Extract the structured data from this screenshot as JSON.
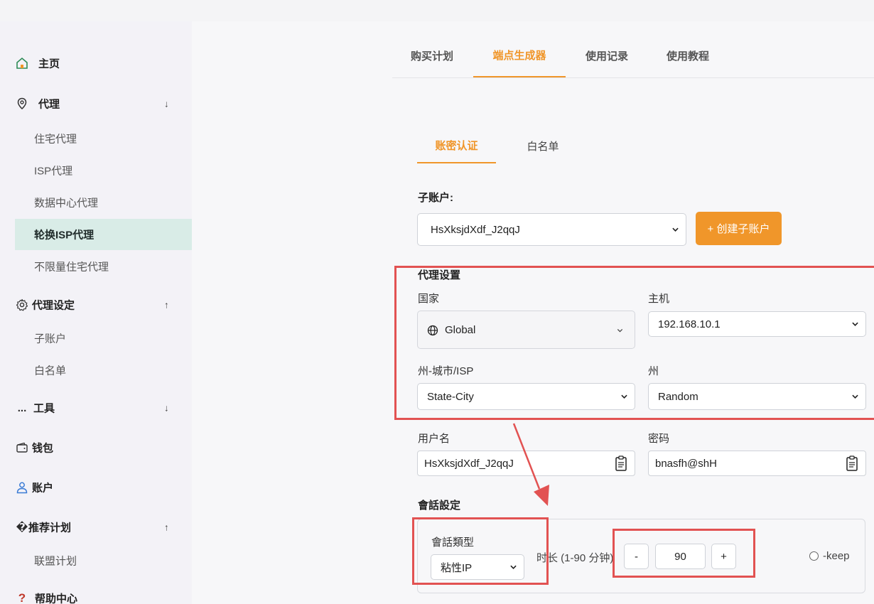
{
  "sidebar": {
    "home": "主页",
    "proxy": "代理",
    "proxy_items": [
      "住宅代理",
      "ISP代理",
      "数据中心代理",
      "轮换ISP代理",
      "不限量住宅代理"
    ],
    "proxy_settings": "代理设定",
    "settings_items": [
      "子账户",
      "白名单"
    ],
    "tools": "工具",
    "tools_prefix": "...",
    "wallet": "钱包",
    "account": "账户",
    "referral": "推荐计划",
    "referral_prefix": "�",
    "referral_items": [
      "联盟计划"
    ],
    "help": "帮助中心",
    "arrow_down": "↓",
    "arrow_up": "↑"
  },
  "top_tabs": [
    "购买计划",
    "端点生成器",
    "使用记录",
    "使用教程"
  ],
  "sub_tabs": [
    "账密认证",
    "白名单"
  ],
  "subaccount": {
    "label": "子账户:",
    "value": "HsXksjdXdf_J2qqJ",
    "create_button": "+ 创建子账户"
  },
  "proxy_settings": {
    "title": "代理设置",
    "country_label": "国家",
    "country_value": "Global",
    "host_label": "主机",
    "host_value": "192.168.10.1",
    "city_label": "州-城市/ISP",
    "city_value": "State-City",
    "state_label": "州",
    "state_value": "Random"
  },
  "credentials": {
    "username_label": "用户名",
    "username_value": "HsXksjdXdf_J2qqJ",
    "password_label": "密码",
    "password_value": "bnasfh@shH"
  },
  "session": {
    "title": "會話設定",
    "type_label": "會話類型",
    "type_value": "粘性IP",
    "duration_label": "时长 (1-90 分钟)",
    "minus": "-",
    "duration_value": "90",
    "plus": "+",
    "keep_label": "-keep"
  },
  "colors": {
    "accent": "#f0962a",
    "highlight": "#e25252",
    "active_nav_bg": "#d9ece7"
  }
}
